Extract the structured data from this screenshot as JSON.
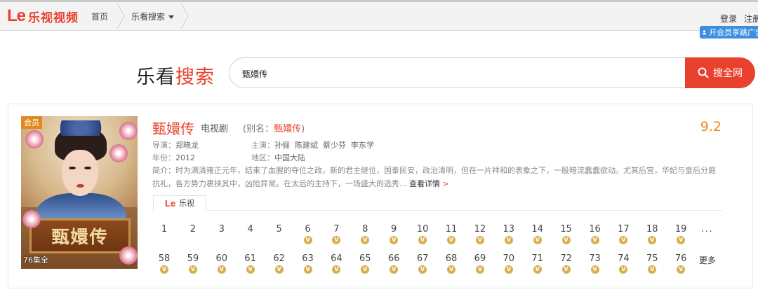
{
  "header": {
    "logo_mark": "Le",
    "logo_name": "乐视视频",
    "crumb_home": "首页",
    "crumb_search": "乐看搜索",
    "login": "登录",
    "register": "注册",
    "vip_promo": "开会员享跳广告"
  },
  "search": {
    "brand_black": "乐看",
    "brand_red": "搜索",
    "query": "甄嬛传",
    "button": "搜全网"
  },
  "result": {
    "vip_badge": "会员",
    "episode_total": "76集全",
    "poster_text": "甄嬛传",
    "title": "甄嬛传",
    "type": "电视剧",
    "alias_prefix": "(别名：",
    "alias_name": "甄嬛传",
    "alias_suffix": ")",
    "score": "9.2",
    "director_label": "导演：",
    "director": "郑晓龙",
    "cast_label": "主演：",
    "cast": "孙俪  陈建斌  蔡少芬  李东学",
    "year_label": "年份：",
    "year": "2012",
    "region_label": "地区：",
    "region": "中国大陆",
    "description": "简介：时为满清雍正元年，结束了血腥的夺位之政，新的君主继位，国泰民安，政治清明，但在一片祥和的表象之下，一股暗流蠢蠢欲动。尤其后宫，华妃与皇后分庭抗礼，各方势力裹挟其中，凶险异常。在太后的主持下，一场盛大的选秀...",
    "details_link": "查看详情",
    "details_arrow": ">",
    "source_tab": "乐视",
    "source_mark": "Le",
    "vip_mark": "V",
    "episodes_row1": [
      "1",
      "2",
      "3",
      "4",
      "5",
      "6",
      "7",
      "8",
      "9",
      "10",
      "11",
      "12",
      "13",
      "14",
      "15",
      "16",
      "17",
      "18",
      "19"
    ],
    "row1_vip": [
      false,
      false,
      false,
      false,
      false,
      true,
      true,
      true,
      true,
      true,
      true,
      true,
      true,
      true,
      true,
      true,
      true,
      true,
      true
    ],
    "row1_more": "...",
    "episodes_row2": [
      "58",
      "59",
      "60",
      "61",
      "62",
      "63",
      "64",
      "65",
      "66",
      "67",
      "68",
      "69",
      "70",
      "71",
      "72",
      "73",
      "74",
      "75",
      "76"
    ],
    "row2_vip": [
      true,
      true,
      true,
      true,
      true,
      true,
      true,
      true,
      true,
      true,
      true,
      true,
      true,
      true,
      true,
      true,
      true,
      true,
      true
    ],
    "row2_more": "更多"
  },
  "colors": {
    "brand_red": "#e8412d",
    "score_orange": "#f08a1e",
    "vip_gold": "#d8b04d",
    "vip_badge": "#e08a1e",
    "promo_blue": "#3b8fe0"
  }
}
